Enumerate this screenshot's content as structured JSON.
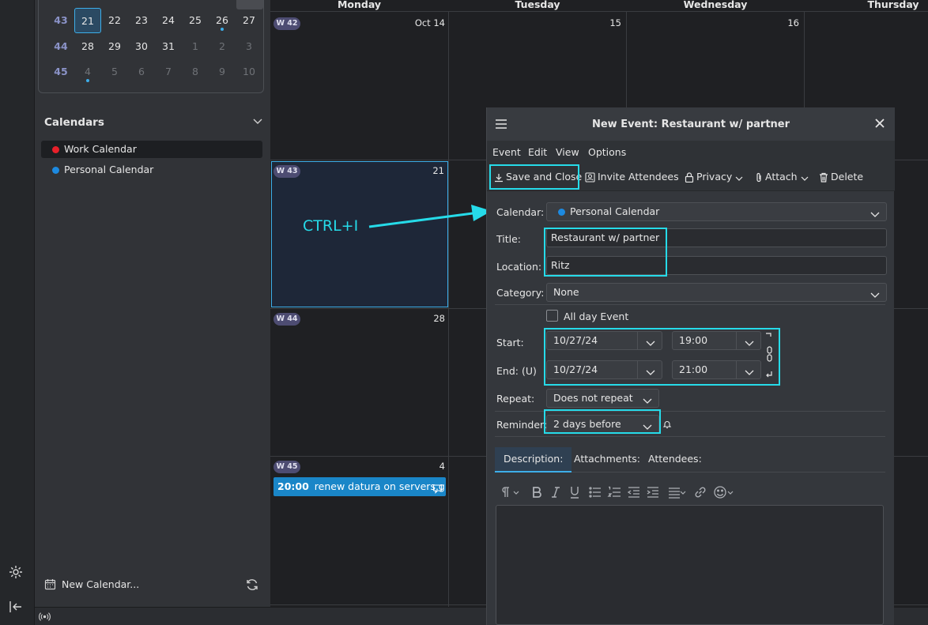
{
  "mini_calendar": {
    "rows": [
      {
        "week": "43",
        "days": [
          "21",
          "22",
          "23",
          "24",
          "25",
          "26",
          "27"
        ]
      },
      {
        "week": "44",
        "days": [
          "28",
          "29",
          "30",
          "31",
          "1",
          "2",
          "3"
        ]
      },
      {
        "week": "45",
        "days": [
          "4",
          "5",
          "6",
          "7",
          "8",
          "9",
          "10"
        ]
      }
    ]
  },
  "sidebar": {
    "calendars_header": "Calendars",
    "calendars": [
      {
        "name": "Work Calendar",
        "color": "#e8202a"
      },
      {
        "name": "Personal Calendar",
        "color": "#1d8ae0"
      }
    ],
    "new_calendar": "New Calendar..."
  },
  "month_view": {
    "columns": [
      "Monday",
      "Tuesday",
      "Wednesday",
      "Thursday"
    ],
    "weeks": [
      {
        "badge": "W 42",
        "day_labels": [
          "Oct 14",
          "15",
          "16"
        ]
      },
      {
        "badge": "W 43",
        "day_labels": [
          "21"
        ]
      },
      {
        "badge": "W 44",
        "day_labels": [
          "28"
        ]
      },
      {
        "badge": "W 45",
        "day_labels": [
          "4"
        ]
      }
    ],
    "event": {
      "time": "20:00",
      "title": "renew datura on servers.g..."
    }
  },
  "annotation": {
    "label": "CTRL+I",
    "color": "#26dbe9"
  },
  "dialog": {
    "title": "New Event: Restaurant w/ partner",
    "menu": [
      "Event",
      "Edit",
      "View",
      "Options"
    ],
    "toolbar": {
      "save_close": "Save and Close",
      "invite": "Invite Attendees",
      "privacy": "Privacy",
      "attach": "Attach",
      "delete": "Delete"
    },
    "labels": {
      "calendar": "Calendar:",
      "title": "Title:",
      "location": "Location:",
      "category": "Category:",
      "all_day": "All day Event",
      "start": "Start:",
      "end": "End: (U)",
      "repeat": "Repeat:",
      "reminder": "Reminder:"
    },
    "values": {
      "calendar": "Personal Calendar",
      "title": "Restaurant w/ partner",
      "location": "Ritz",
      "category": "None",
      "start_date": "10/27/24",
      "start_time": "19:00",
      "end_date": "10/27/24",
      "end_time": "21:00",
      "repeat": "Does not repeat",
      "reminder": "2 days before"
    },
    "tabs": [
      "Description:",
      "Attachments:",
      "Attendees:"
    ]
  }
}
